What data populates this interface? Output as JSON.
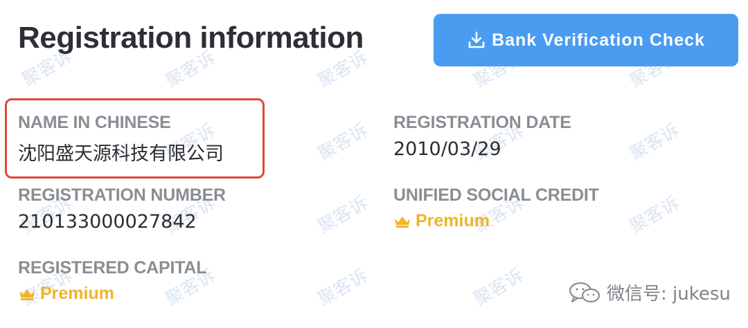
{
  "header": {
    "title": "Registration information",
    "bank_button_label": "Bank Verification Check"
  },
  "fields": {
    "name_in_chinese": {
      "label": "NAME IN CHINESE",
      "value": "沈阳盛天源科技有限公司"
    },
    "registration_date": {
      "label": "REGISTRATION DATE",
      "value": "2010/03/29"
    },
    "registration_number": {
      "label": "REGISTRATION NUMBER",
      "value": "210133000027842"
    },
    "unified_social_credit": {
      "label": "UNIFIED SOCIAL CREDIT",
      "premium_label": "Premium"
    },
    "registered_capital": {
      "label": "REGISTERED CAPITAL",
      "premium_label": "Premium"
    }
  },
  "watermark": {
    "text": "聚客诉"
  },
  "footer": {
    "wechat_text": "微信号: jukesu"
  },
  "icons": {
    "download": "download-icon",
    "crown": "crown-icon",
    "wechat": "wechat-icon"
  },
  "colors": {
    "accent": "#4a9cf0",
    "premium": "#f0b429",
    "highlight": "#e0463b",
    "label": "#8a8d93"
  }
}
